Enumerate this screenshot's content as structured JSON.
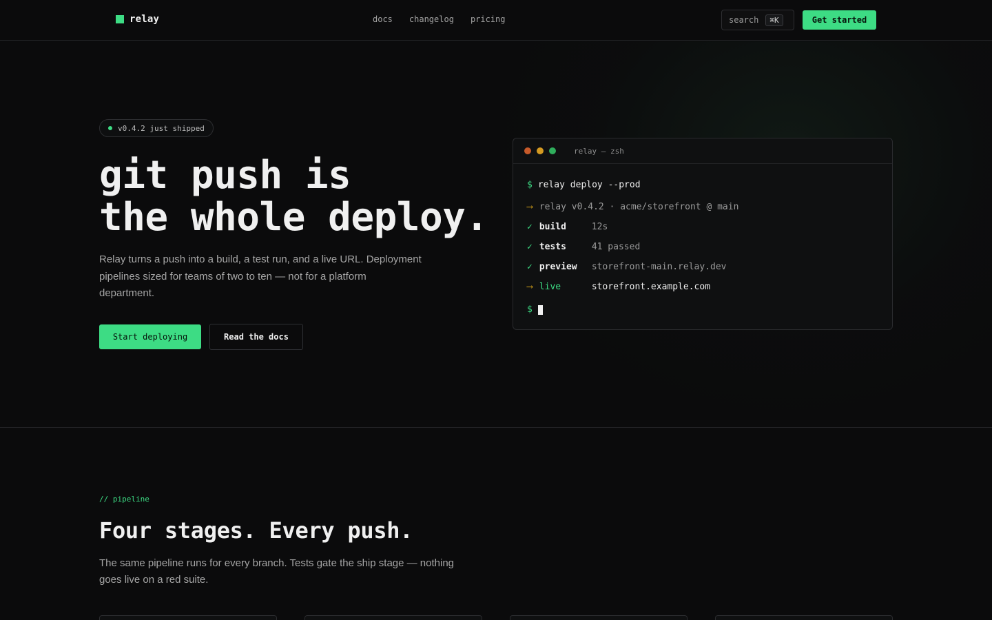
{
  "brand": {
    "name": "relay",
    "accent": "#3ddc84"
  },
  "nav": {
    "links": [
      "docs",
      "changelog",
      "pricing"
    ],
    "search_label": "search",
    "search_shortcut": "⌘K",
    "cta": "Get started"
  },
  "hero": {
    "badge": "v0.4.2 just shipped",
    "title_line1": "git push is",
    "title_line2": "the whole deploy.",
    "subtitle": "Relay turns a push into a build, a test run, and a live URL. Deployment pipelines sized for teams of two to ten — not for a platform department.",
    "primary_button": "Start deploying",
    "secondary_button": "Read the docs"
  },
  "terminal": {
    "title": "relay — zsh",
    "prompt": "$",
    "command": "relay deploy --prod",
    "arrow": "⟶",
    "check": "✓",
    "info": "relay v0.4.2 · acme/storefront @ main",
    "steps": [
      {
        "name": "build",
        "value": "12s"
      },
      {
        "name": "tests",
        "value": "41 passed"
      },
      {
        "name": "preview",
        "value": "storefront-main.relay.dev"
      }
    ],
    "live": {
      "name": "live",
      "value": "storefront.example.com"
    }
  },
  "pipeline": {
    "tag": "// pipeline",
    "title": "Four stages. Every push.",
    "subtitle": "The same pipeline runs for every branch. Tests gate the ship stage — nothing goes live on a red suite."
  }
}
